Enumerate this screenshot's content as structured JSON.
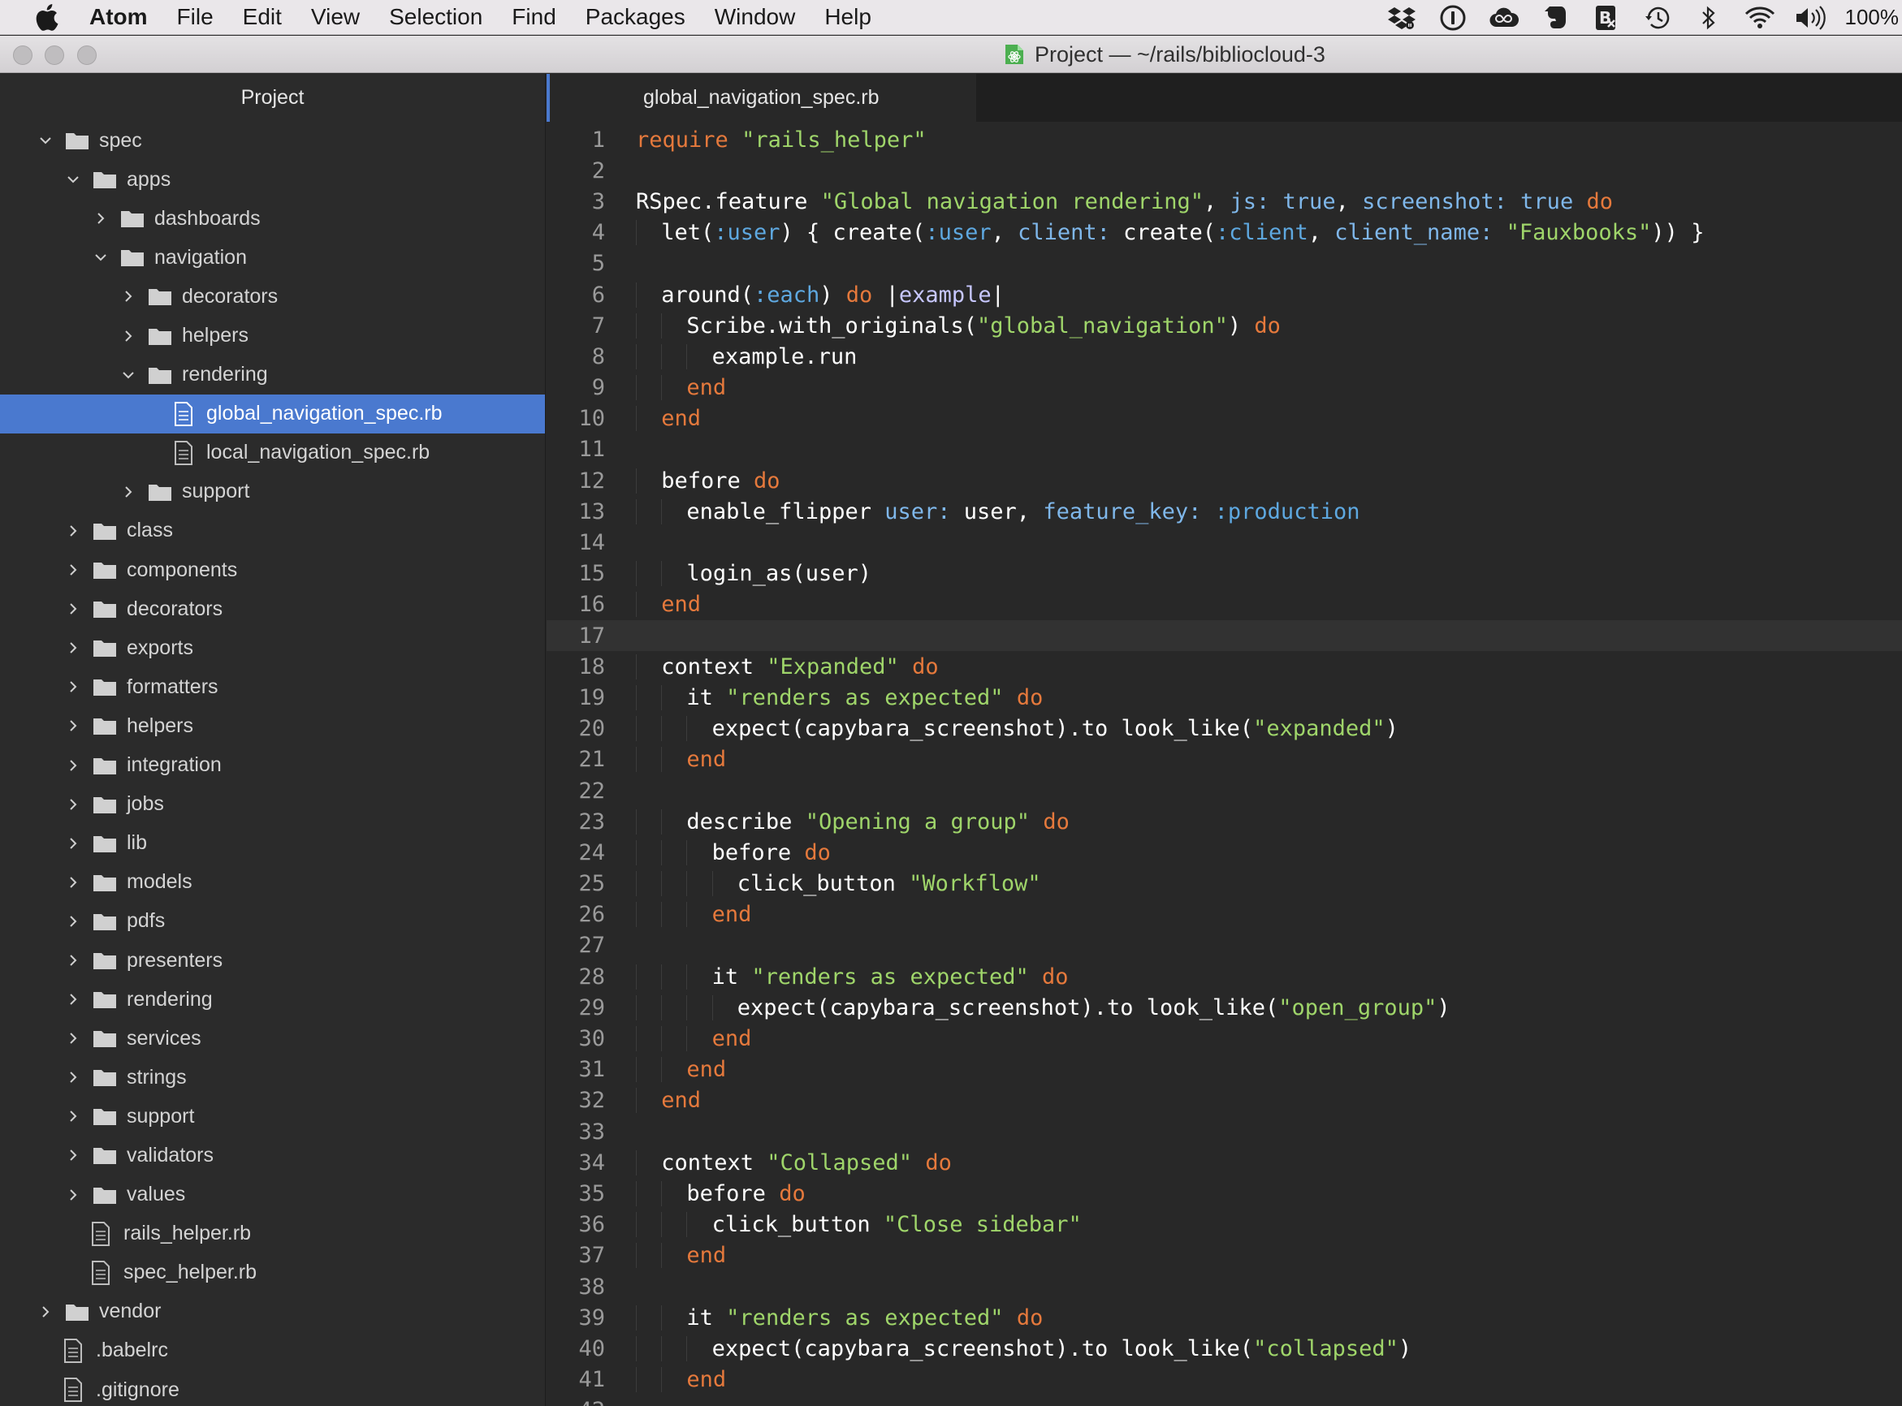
{
  "menubar": {
    "app_name": "Atom",
    "items": [
      "File",
      "Edit",
      "View",
      "Selection",
      "Find",
      "Packages",
      "Window",
      "Help"
    ],
    "status_icons": [
      "dropbox-icon",
      "onepassword-icon",
      "creative-cloud-icon",
      "evernote-icon",
      "bibdesk-icon",
      "time-machine-icon",
      "bluetooth-icon",
      "wifi-icon",
      "volume-icon"
    ],
    "battery": "100%"
  },
  "window": {
    "title": "Project — ~/rails/bibliocloud-3"
  },
  "tree": {
    "header": "Project",
    "items": [
      {
        "label": "spec",
        "type": "dir",
        "depth": 0,
        "expanded": true
      },
      {
        "label": "apps",
        "type": "dir",
        "depth": 1,
        "expanded": true
      },
      {
        "label": "dashboards",
        "type": "dir",
        "depth": 2,
        "expanded": false
      },
      {
        "label": "navigation",
        "type": "dir",
        "depth": 2,
        "expanded": true
      },
      {
        "label": "decorators",
        "type": "dir",
        "depth": 3,
        "expanded": false
      },
      {
        "label": "helpers",
        "type": "dir",
        "depth": 3,
        "expanded": false
      },
      {
        "label": "rendering",
        "type": "dir",
        "depth": 3,
        "expanded": true
      },
      {
        "label": "global_navigation_spec.rb",
        "type": "file",
        "depth": 4,
        "selected": true
      },
      {
        "label": "local_navigation_spec.rb",
        "type": "file",
        "depth": 4
      },
      {
        "label": "support",
        "type": "dir",
        "depth": 3,
        "expanded": false
      },
      {
        "label": "class",
        "type": "dir",
        "depth": 1,
        "expanded": false
      },
      {
        "label": "components",
        "type": "dir",
        "depth": 1,
        "expanded": false
      },
      {
        "label": "decorators",
        "type": "dir",
        "depth": 1,
        "expanded": false
      },
      {
        "label": "exports",
        "type": "dir",
        "depth": 1,
        "expanded": false
      },
      {
        "label": "formatters",
        "type": "dir",
        "depth": 1,
        "expanded": false
      },
      {
        "label": "helpers",
        "type": "dir",
        "depth": 1,
        "expanded": false
      },
      {
        "label": "integration",
        "type": "dir",
        "depth": 1,
        "expanded": false
      },
      {
        "label": "jobs",
        "type": "dir",
        "depth": 1,
        "expanded": false
      },
      {
        "label": "lib",
        "type": "dir",
        "depth": 1,
        "expanded": false
      },
      {
        "label": "models",
        "type": "dir",
        "depth": 1,
        "expanded": false
      },
      {
        "label": "pdfs",
        "type": "dir",
        "depth": 1,
        "expanded": false
      },
      {
        "label": "presenters",
        "type": "dir",
        "depth": 1,
        "expanded": false
      },
      {
        "label": "rendering",
        "type": "dir",
        "depth": 1,
        "expanded": false
      },
      {
        "label": "services",
        "type": "dir",
        "depth": 1,
        "expanded": false
      },
      {
        "label": "strings",
        "type": "dir",
        "depth": 1,
        "expanded": false
      },
      {
        "label": "support",
        "type": "dir",
        "depth": 1,
        "expanded": false
      },
      {
        "label": "validators",
        "type": "dir",
        "depth": 1,
        "expanded": false
      },
      {
        "label": "values",
        "type": "dir",
        "depth": 1,
        "expanded": false
      },
      {
        "label": "rails_helper.rb",
        "type": "file",
        "depth": 1
      },
      {
        "label": "spec_helper.rb",
        "type": "file",
        "depth": 1
      },
      {
        "label": "vendor",
        "type": "dir",
        "depth": 0,
        "expanded": false
      },
      {
        "label": ".babelrc",
        "type": "file",
        "depth": 0
      },
      {
        "label": ".gitignore",
        "type": "file",
        "depth": 0
      }
    ]
  },
  "editor": {
    "tab_label": "global_navigation_spec.rb",
    "cursor_line": 17,
    "lines": [
      {
        "n": "1",
        "indent": 0,
        "tokens": [
          [
            "kw",
            "require"
          ],
          [
            "plain",
            " "
          ],
          [
            "str",
            "\"rails_helper\""
          ]
        ]
      },
      {
        "n": "2",
        "indent": 0,
        "tokens": []
      },
      {
        "n": "3",
        "indent": 0,
        "tokens": [
          [
            "plain",
            "RSpec.feature "
          ],
          [
            "str",
            "\"Global navigation rendering\""
          ],
          [
            "plain",
            ", "
          ],
          [
            "const",
            "js:"
          ],
          [
            "plain",
            " "
          ],
          [
            "const",
            "true"
          ],
          [
            "plain",
            ", "
          ],
          [
            "const",
            "screenshot:"
          ],
          [
            "plain",
            " "
          ],
          [
            "const",
            "true"
          ],
          [
            "plain",
            " "
          ],
          [
            "kw",
            "do"
          ]
        ]
      },
      {
        "n": "4",
        "indent": 1,
        "tokens": [
          [
            "plain",
            "let("
          ],
          [
            "sym",
            ":user"
          ],
          [
            "plain",
            ") { create("
          ],
          [
            "sym",
            ":user"
          ],
          [
            "plain",
            ", "
          ],
          [
            "const",
            "client:"
          ],
          [
            "plain",
            " create("
          ],
          [
            "sym",
            ":client"
          ],
          [
            "plain",
            ", "
          ],
          [
            "const",
            "client_name:"
          ],
          [
            "plain",
            " "
          ],
          [
            "str",
            "\"Fauxbooks\""
          ],
          [
            "plain",
            ")) }"
          ]
        ]
      },
      {
        "n": "5",
        "indent": 1,
        "tokens": []
      },
      {
        "n": "6",
        "indent": 1,
        "tokens": [
          [
            "plain",
            "around("
          ],
          [
            "sym",
            ":each"
          ],
          [
            "plain",
            ") "
          ],
          [
            "kw",
            "do"
          ],
          [
            "plain",
            " |"
          ],
          [
            "param",
            "example"
          ],
          [
            "plain",
            "|"
          ]
        ]
      },
      {
        "n": "7",
        "indent": 2,
        "tokens": [
          [
            "plain",
            "Scribe.with_originals("
          ],
          [
            "str",
            "\"global_navigation\""
          ],
          [
            "plain",
            ") "
          ],
          [
            "kw",
            "do"
          ]
        ]
      },
      {
        "n": "8",
        "indent": 3,
        "tokens": [
          [
            "plain",
            "example.run"
          ]
        ]
      },
      {
        "n": "9",
        "indent": 2,
        "tokens": [
          [
            "kw",
            "end"
          ]
        ]
      },
      {
        "n": "10",
        "indent": 1,
        "tokens": [
          [
            "kw",
            "end"
          ]
        ]
      },
      {
        "n": "11",
        "indent": 1,
        "tokens": []
      },
      {
        "n": "12",
        "indent": 1,
        "tokens": [
          [
            "plain",
            "before "
          ],
          [
            "kw",
            "do"
          ]
        ]
      },
      {
        "n": "13",
        "indent": 2,
        "tokens": [
          [
            "plain",
            "enable_flipper "
          ],
          [
            "const",
            "user:"
          ],
          [
            "plain",
            " user, "
          ],
          [
            "const",
            "feature_key:"
          ],
          [
            "plain",
            " "
          ],
          [
            "sym",
            ":production"
          ]
        ]
      },
      {
        "n": "14",
        "indent": 2,
        "tokens": []
      },
      {
        "n": "15",
        "indent": 2,
        "tokens": [
          [
            "plain",
            "login_as(user)"
          ]
        ]
      },
      {
        "n": "16",
        "indent": 1,
        "tokens": [
          [
            "kw",
            "end"
          ]
        ]
      },
      {
        "n": "17",
        "indent": 1,
        "tokens": []
      },
      {
        "n": "18",
        "indent": 1,
        "tokens": [
          [
            "plain",
            "context "
          ],
          [
            "str",
            "\"Expanded\""
          ],
          [
            "plain",
            " "
          ],
          [
            "kw",
            "do"
          ]
        ]
      },
      {
        "n": "19",
        "indent": 2,
        "tokens": [
          [
            "plain",
            "it "
          ],
          [
            "str",
            "\"renders as expected\""
          ],
          [
            "plain",
            " "
          ],
          [
            "kw",
            "do"
          ]
        ]
      },
      {
        "n": "20",
        "indent": 3,
        "tokens": [
          [
            "plain",
            "expect(capybara_screenshot).to look_like("
          ],
          [
            "str",
            "\"expanded\""
          ],
          [
            "plain",
            ")"
          ]
        ]
      },
      {
        "n": "21",
        "indent": 2,
        "tokens": [
          [
            "kw",
            "end"
          ]
        ]
      },
      {
        "n": "22",
        "indent": 2,
        "tokens": []
      },
      {
        "n": "23",
        "indent": 2,
        "tokens": [
          [
            "plain",
            "describe "
          ],
          [
            "str",
            "\"Opening a group\""
          ],
          [
            "plain",
            " "
          ],
          [
            "kw",
            "do"
          ]
        ]
      },
      {
        "n": "24",
        "indent": 3,
        "tokens": [
          [
            "plain",
            "before "
          ],
          [
            "kw",
            "do"
          ]
        ]
      },
      {
        "n": "25",
        "indent": 4,
        "tokens": [
          [
            "plain",
            "click_button "
          ],
          [
            "str",
            "\"Workflow\""
          ]
        ]
      },
      {
        "n": "26",
        "indent": 3,
        "tokens": [
          [
            "kw",
            "end"
          ]
        ]
      },
      {
        "n": "27",
        "indent": 3,
        "tokens": []
      },
      {
        "n": "28",
        "indent": 3,
        "tokens": [
          [
            "plain",
            "it "
          ],
          [
            "str",
            "\"renders as expected\""
          ],
          [
            "plain",
            " "
          ],
          [
            "kw",
            "do"
          ]
        ]
      },
      {
        "n": "29",
        "indent": 4,
        "tokens": [
          [
            "plain",
            "expect(capybara_screenshot).to look_like("
          ],
          [
            "str",
            "\"open_group\""
          ],
          [
            "plain",
            ")"
          ]
        ]
      },
      {
        "n": "30",
        "indent": 3,
        "tokens": [
          [
            "kw",
            "end"
          ]
        ]
      },
      {
        "n": "31",
        "indent": 2,
        "tokens": [
          [
            "kw",
            "end"
          ]
        ]
      },
      {
        "n": "32",
        "indent": 1,
        "tokens": [
          [
            "kw",
            "end"
          ]
        ]
      },
      {
        "n": "33",
        "indent": 1,
        "tokens": []
      },
      {
        "n": "34",
        "indent": 1,
        "tokens": [
          [
            "plain",
            "context "
          ],
          [
            "str",
            "\"Collapsed\""
          ],
          [
            "plain",
            " "
          ],
          [
            "kw",
            "do"
          ]
        ]
      },
      {
        "n": "35",
        "indent": 2,
        "tokens": [
          [
            "plain",
            "before "
          ],
          [
            "kw",
            "do"
          ]
        ]
      },
      {
        "n": "36",
        "indent": 3,
        "tokens": [
          [
            "plain",
            "click_button "
          ],
          [
            "str",
            "\"Close sidebar\""
          ]
        ]
      },
      {
        "n": "37",
        "indent": 2,
        "tokens": [
          [
            "kw",
            "end"
          ]
        ]
      },
      {
        "n": "38",
        "indent": 2,
        "tokens": []
      },
      {
        "n": "39",
        "indent": 2,
        "tokens": [
          [
            "plain",
            "it "
          ],
          [
            "str",
            "\"renders as expected\""
          ],
          [
            "plain",
            " "
          ],
          [
            "kw",
            "do"
          ]
        ]
      },
      {
        "n": "40",
        "indent": 3,
        "tokens": [
          [
            "plain",
            "expect(capybara_screenshot).to look_like("
          ],
          [
            "str",
            "\"collapsed\""
          ],
          [
            "plain",
            ")"
          ]
        ]
      },
      {
        "n": "41",
        "indent": 2,
        "tokens": [
          [
            "kw",
            "end"
          ]
        ]
      },
      {
        "n": "42",
        "indent": 2,
        "tokens": []
      }
    ]
  }
}
